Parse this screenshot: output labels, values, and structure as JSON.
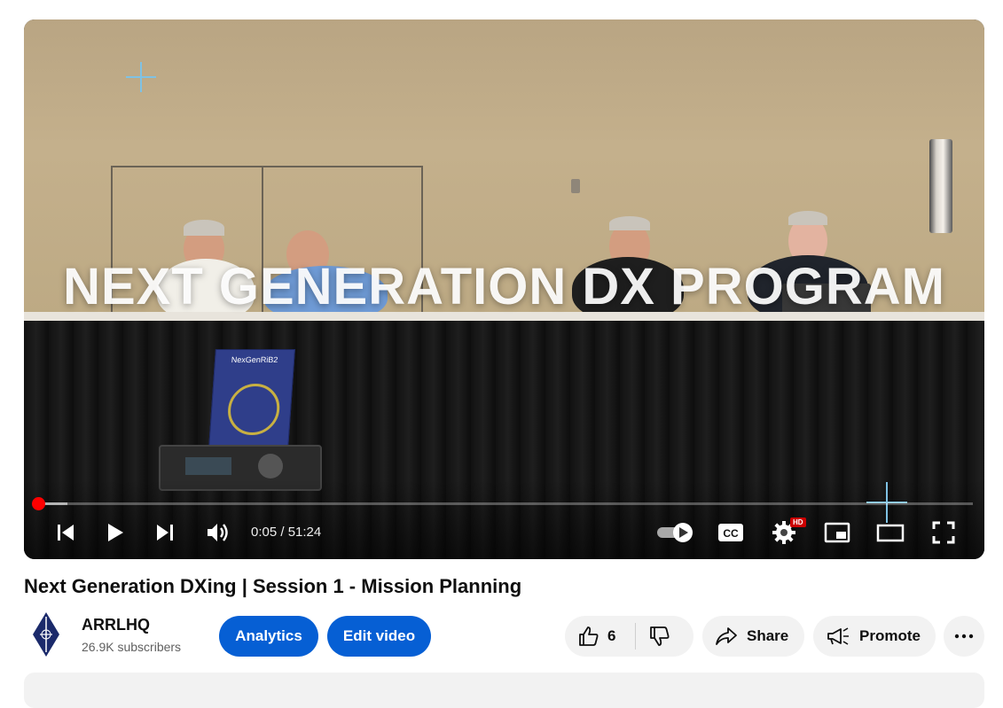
{
  "player": {
    "overlay_title": "NEXT GENERATION DX PROGRAM",
    "sign_text": "NexGenRiB2",
    "time_display": "0:05 / 51:24",
    "progress_fraction": 0.0,
    "buffer_fraction": 0.034,
    "hd_badge": "HD",
    "cc_label": "CC",
    "accent_color": "#ff0000"
  },
  "video": {
    "title": "Next Generation DXing | Session 1 - Mission Planning"
  },
  "channel": {
    "name": "ARRLHQ",
    "subscribers": "26.9K subscribers"
  },
  "actions": {
    "analytics_label": "Analytics",
    "edit_video_label": "Edit video",
    "like_count": "6",
    "share_label": "Share",
    "promote_label": "Promote",
    "button_color": "#065fd4"
  },
  "icons": [
    "previous-icon",
    "play-icon",
    "next-icon",
    "volume-icon",
    "autoplay-toggle-icon",
    "captions-icon",
    "settings-icon",
    "miniplayer-icon",
    "theater-icon",
    "fullscreen-icon",
    "like-icon",
    "dislike-icon",
    "share-icon",
    "promote-icon",
    "more-icon"
  ]
}
